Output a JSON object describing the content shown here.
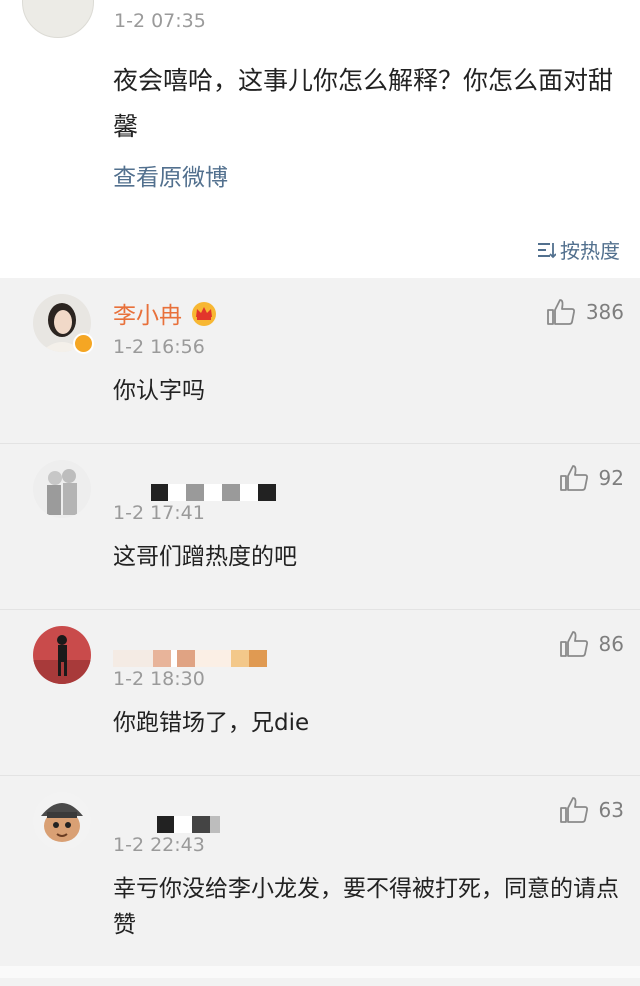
{
  "post": {
    "time": "1-2 07:35",
    "text": "夜会嘻哈，这事儿你怎么解释？你怎么面对甜馨",
    "view_original": "查看原微博",
    "sort_label": "按热度"
  },
  "comments": [
    {
      "name": "李小冉",
      "time": "1-2 16:56",
      "text": "你认字吗",
      "likes": "386"
    },
    {
      "name": "",
      "time": "1-2 17:41",
      "text": "这哥们蹭热度的吧",
      "likes": "92"
    },
    {
      "name": "",
      "time": "1-2 18:30",
      "text": "你跑错场了，兄die",
      "likes": "86"
    },
    {
      "name": "",
      "time": "1-2 22:43",
      "text": "幸亏你没给李小龙发，要不得被打死，同意的请点赞",
      "likes": "63"
    }
  ],
  "colors": {
    "link": "#52708e",
    "username": "#e8703a",
    "meta": "#9a9a9a"
  },
  "icons": [
    "sort-icon",
    "thumbs-up-icon",
    "crown-badge-icon",
    "verified-badge-icon"
  ]
}
